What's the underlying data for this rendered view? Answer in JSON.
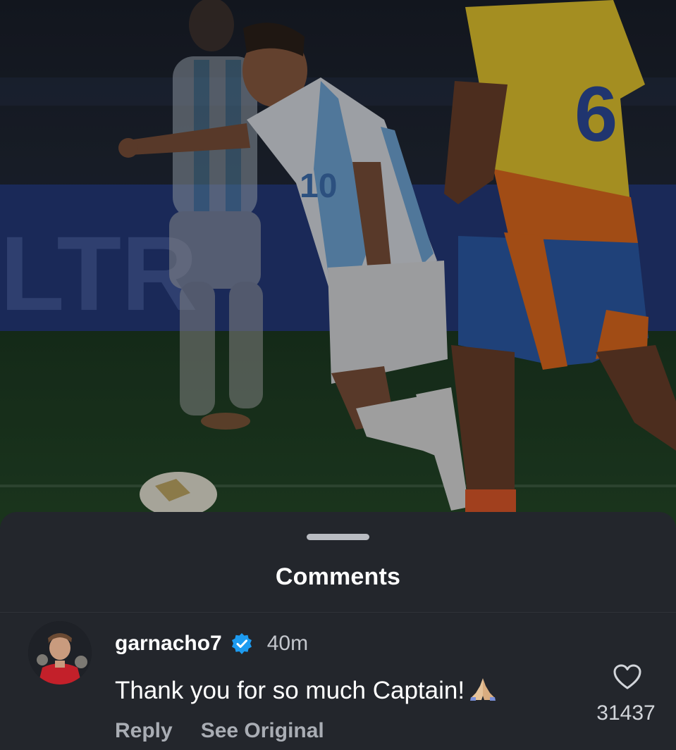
{
  "background_photo": {
    "description_icon": "football-match-photo",
    "dim_overlay": "#000000"
  },
  "comments_sheet": {
    "title": "Comments",
    "colors": {
      "sheet_bg": "#23262c",
      "text_primary": "#ffffff",
      "text_secondary": "#a9adb4",
      "verified": "#1d9bf0"
    }
  },
  "comments": [
    {
      "username": "garnacho7",
      "verified": true,
      "timestamp": "40m",
      "text": "Thank you for so much Captain!",
      "emoji_icon": "folded-hands-icon",
      "actions": {
        "reply": "Reply",
        "see_original": "See Original"
      },
      "like_icon": "heart-outline-icon",
      "like_count": "31437"
    }
  ]
}
